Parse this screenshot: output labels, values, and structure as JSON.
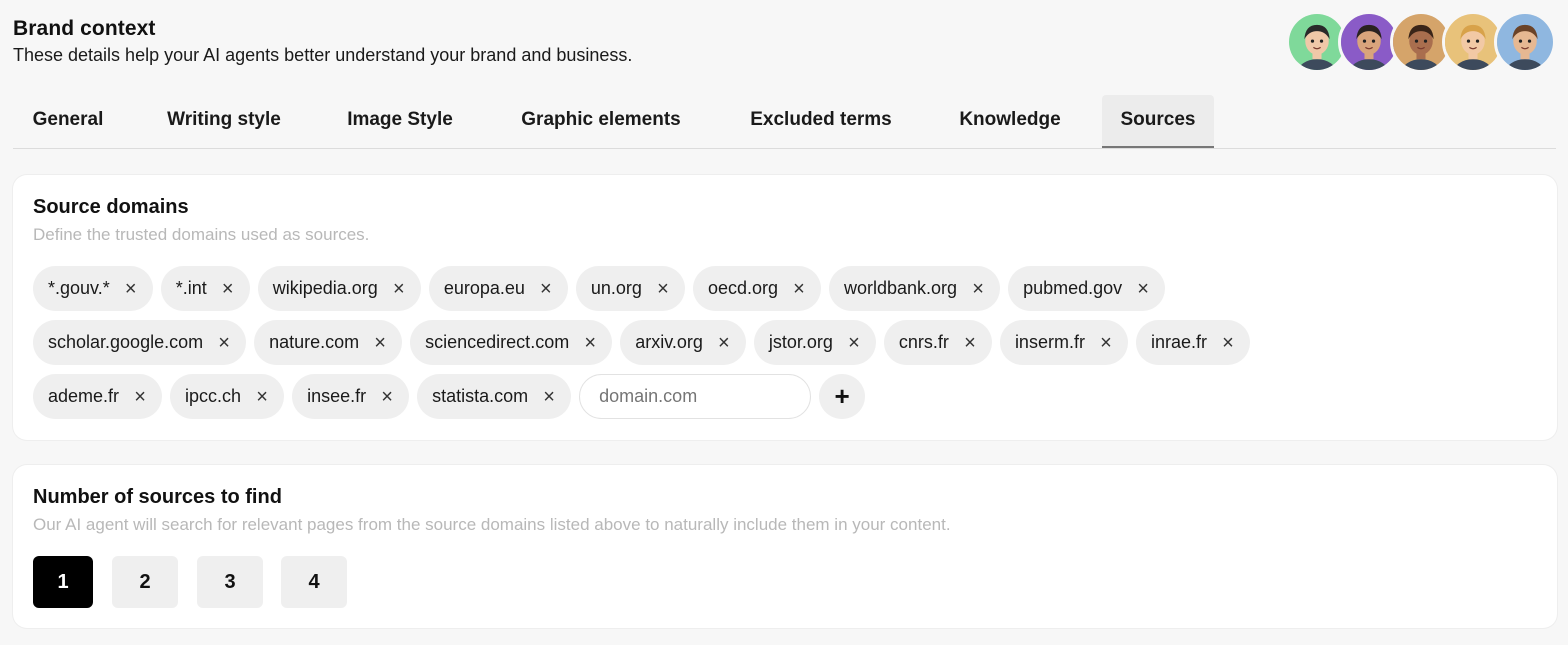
{
  "header": {
    "title": "Brand context",
    "subtitle": "These details help your AI agents better understand your brand and business."
  },
  "avatars": [
    {
      "name": "avatar-1",
      "bg": "#7fd99a",
      "skin": "#f0c8a8",
      "hair": "#2a2a2a"
    },
    {
      "name": "avatar-2",
      "bg": "#8a5bc7",
      "skin": "#d9a47c",
      "hair": "#2a2220"
    },
    {
      "name": "avatar-3",
      "bg": "#d5a46a",
      "skin": "#a96e4e",
      "hair": "#3a2418"
    },
    {
      "name": "avatar-4",
      "bg": "#e8c27a",
      "skin": "#f2c9a5",
      "hair": "#d8a24a"
    },
    {
      "name": "avatar-5",
      "bg": "#8fb7e0",
      "skin": "#e6b892",
      "hair": "#6b4328"
    }
  ],
  "tabs": [
    {
      "label": "General"
    },
    {
      "label": "Writing style"
    },
    {
      "label": "Image Style"
    },
    {
      "label": "Graphic elements"
    },
    {
      "label": "Excluded terms"
    },
    {
      "label": "Knowledge"
    },
    {
      "label": "Sources",
      "active": true
    }
  ],
  "source_domains": {
    "title": "Source domains",
    "description": "Define the trusted domains used as sources.",
    "domains": [
      "*.gouv.*",
      "*.int",
      "wikipedia.org",
      "europa.eu",
      "un.org",
      "oecd.org",
      "worldbank.org",
      "pubmed.gov",
      "scholar.google.com",
      "nature.com",
      "sciencedirect.com",
      "arxiv.org",
      "jstor.org",
      "cnrs.fr",
      "inserm.fr",
      "inrae.fr",
      "ademe.fr",
      "ipcc.ch",
      "insee.fr",
      "statista.com"
    ],
    "remove_glyph": "×",
    "input_placeholder": "domain.com",
    "add_glyph": "+"
  },
  "number_of_sources": {
    "title": "Number of sources to find",
    "description": "Our AI agent will search for relevant pages from the source domains listed above to naturally include them in your content.",
    "options": [
      "1",
      "2",
      "3",
      "4"
    ],
    "selected": "1"
  }
}
